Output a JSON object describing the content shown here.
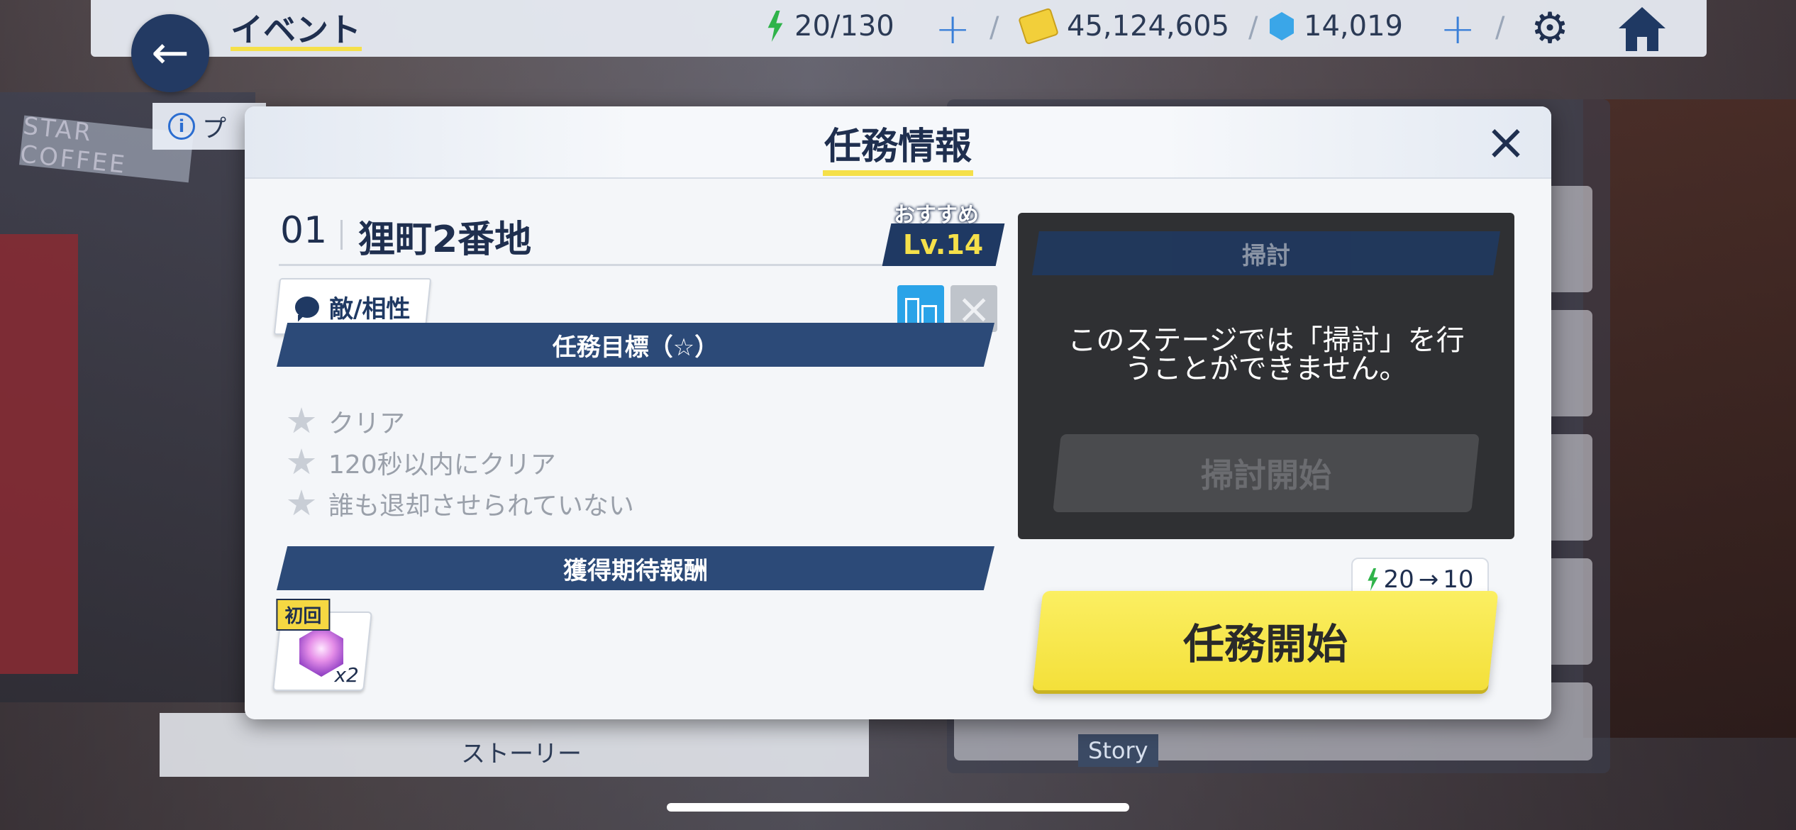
{
  "topbar": {
    "title": "イベント",
    "energy": "20/130",
    "credits": "45,124,605",
    "gems": "14,019",
    "back_icon": "arrow-left-icon",
    "settings_icon": "gear-icon",
    "home_icon": "home-icon"
  },
  "background": {
    "shop_sign": "STAR COFFEE",
    "info_chip_text": "プ",
    "story_tab_label": "ストーリー",
    "story_badge": "Story"
  },
  "modal": {
    "title": "任務情報",
    "stage_number": "01",
    "stage_name": "狸町2番地",
    "recommended_label": "おすすめ",
    "recommended_level": "Lv.14",
    "enemy_button": "敵/相性",
    "objectives_header": "任務目標（☆）",
    "objectives": [
      "クリア",
      "120秒以内にクリア",
      "誰も退却させられていない"
    ],
    "rewards_header": "獲得期待報酬",
    "reward": {
      "badge": "初回",
      "count": "x2"
    },
    "sweep": {
      "header": "掃討",
      "message": "このステージでは「掃討」を行うことができません。",
      "button": "掃討開始"
    },
    "cost": {
      "from": "20",
      "to": "10"
    },
    "start_button": "任務開始"
  },
  "colors": {
    "navy": "#1f3963",
    "accent_yellow": "#f5e04a",
    "terrain_blue": "#2aa3e8"
  }
}
